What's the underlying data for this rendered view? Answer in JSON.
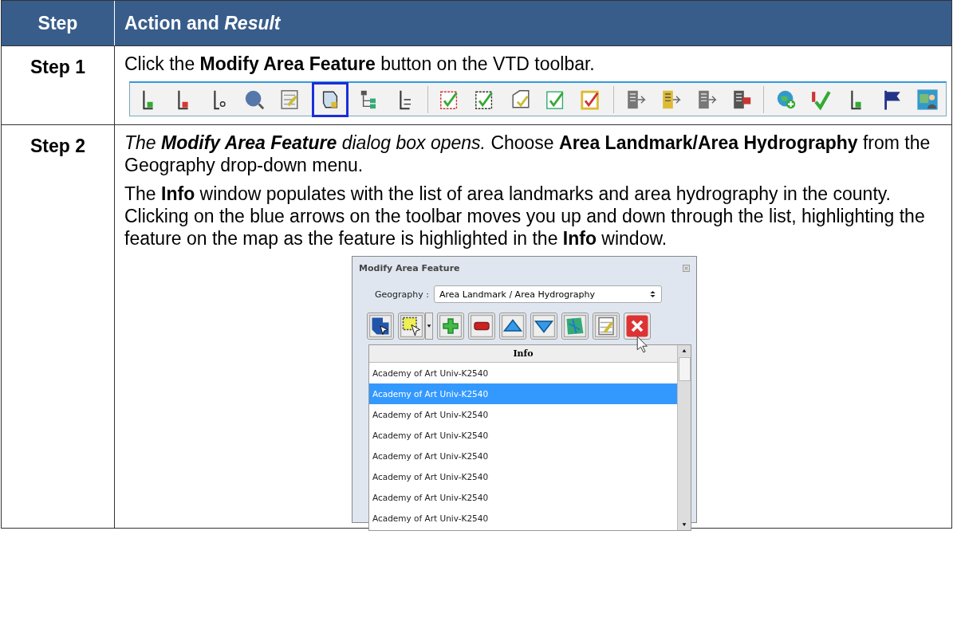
{
  "table": {
    "columns": [
      "Step",
      "Action and *Result*"
    ],
    "rows": [
      {
        "step": "Step 1",
        "paragraphs": [
          {
            "text": "Click the **Modify Area Feature** button on the VTD toolbar."
          }
        ],
        "toolbar": [
          [
            {
              "kind": "vertex-add",
              "selected": false
            },
            {
              "kind": "vertex-delete",
              "selected": false
            },
            {
              "kind": "vertex-cut",
              "selected": false
            },
            {
              "kind": "search-a",
              "selected": false
            },
            {
              "kind": "edit-table",
              "selected": false
            },
            {
              "kind": "area",
              "selected": true
            },
            {
              "kind": "tree",
              "selected": false
            },
            {
              "kind": "vertex-move",
              "selected": false
            }
          ],
          [
            {
              "kind": "check-red",
              "selected": false
            },
            {
              "kind": "check-dark",
              "selected": false
            },
            {
              "kind": "check-outline",
              "selected": false
            },
            {
              "kind": "check-green",
              "selected": false
            },
            {
              "kind": "check-yellow",
              "selected": false
            }
          ],
          [
            {
              "kind": "building",
              "selected": false
            },
            {
              "kind": "building-yellow",
              "selected": false
            },
            {
              "kind": "building",
              "selected": false
            },
            {
              "kind": "building-red",
              "selected": false
            }
          ],
          [
            {
              "kind": "globe",
              "selected": false
            },
            {
              "kind": "check-2020",
              "selected": false
            },
            {
              "kind": "vertex-add",
              "selected": false
            },
            {
              "kind": "flag",
              "selected": false
            },
            {
              "kind": "map",
              "selected": false
            }
          ]
        ]
      },
      {
        "step": "Step 2",
        "paragraphs": [
          {
            "lead": "The **Modify Area Feature** dialog box opens.",
            "text": "Choose **Area Landmark/Area Hydrography** from the Geography drop-down menu."
          },
          {
            "text": "The **Info** window populates with the list of area landmarks and area hydrography in the county. Clicking on the blue arrows on the toolbar moves you up and down through the list, highlighting the feature on the map as the feature is highlighted in the **Info** window."
          }
        ],
        "dialog": {
          "title": "Modify Area Feature",
          "geography_label": "Geography :",
          "geography_value": "Area Landmark / Area Hydrography",
          "tools": [
            {
              "kind": "select-area"
            },
            {
              "kind": "select-box"
            },
            {
              "kind": "add"
            },
            {
              "kind": "remove"
            },
            {
              "kind": "up"
            },
            {
              "kind": "down"
            },
            {
              "kind": "map"
            },
            {
              "kind": "edit-table"
            },
            {
              "kind": "close"
            }
          ],
          "list_header": "Info",
          "items": [
            {
              "text": "Academy of Art Univ-K2540",
              "selected": false
            },
            {
              "text": "Academy of Art Univ-K2540",
              "selected": true
            },
            {
              "text": "Academy of Art Univ-K2540",
              "selected": false
            },
            {
              "text": "Academy of Art Univ-K2540",
              "selected": false
            },
            {
              "text": "Academy of Art Univ-K2540",
              "selected": false
            },
            {
              "text": "Academy of Art Univ-K2540",
              "selected": false
            },
            {
              "text": "Academy of Art Univ-K2540",
              "selected": false
            },
            {
              "text": "Academy of Art Univ-K2540",
              "selected": false
            }
          ]
        }
      }
    ]
  }
}
